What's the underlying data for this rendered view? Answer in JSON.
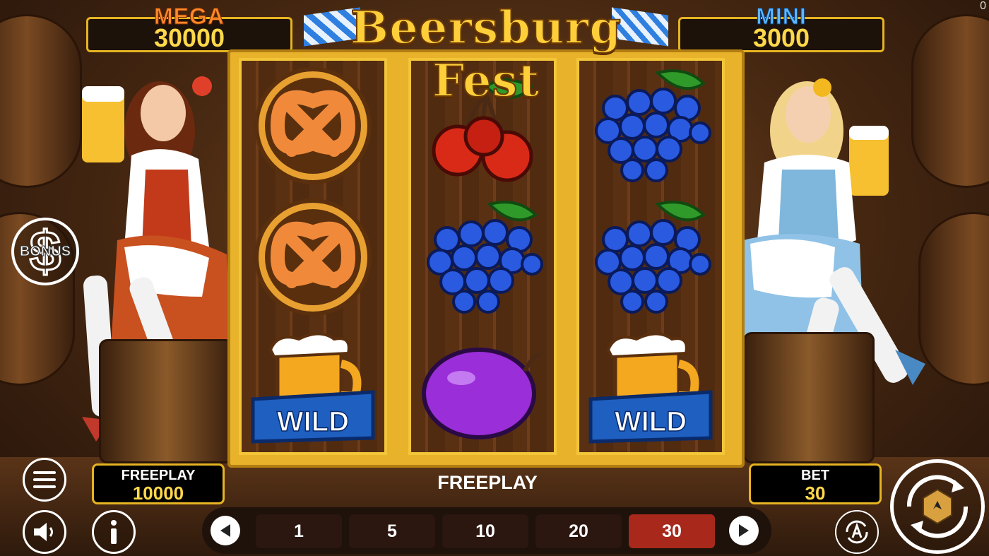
{
  "game": {
    "title": "Beersburg Fest"
  },
  "jackpots": {
    "mega": {
      "label": "MEGA",
      "value": "30000"
    },
    "mini": {
      "label": "MINI",
      "value": "3000"
    }
  },
  "reels": [
    [
      "pretzel",
      "pretzel",
      "wild-beer"
    ],
    [
      "cherries",
      "grapes",
      "plum"
    ],
    [
      "grapes",
      "grapes",
      "wild-beer"
    ]
  ],
  "wild_label": "WILD",
  "bonus_label": "BONUS",
  "balance": {
    "label": "FREEPLAY",
    "value": "10000"
  },
  "bet": {
    "label": "BET",
    "value": "30"
  },
  "mode_text": "FREEPLAY",
  "bet_options": [
    "1",
    "5",
    "10",
    "20",
    "30"
  ],
  "bet_selected": "30",
  "corner_counter": "0",
  "colors": {
    "frame_gold": "#e8b22a",
    "value_yellow": "#ffd84a",
    "active_bet": "#a8281c",
    "mega_orange": "#ff8a2a",
    "mini_blue": "#5ab8ff"
  }
}
